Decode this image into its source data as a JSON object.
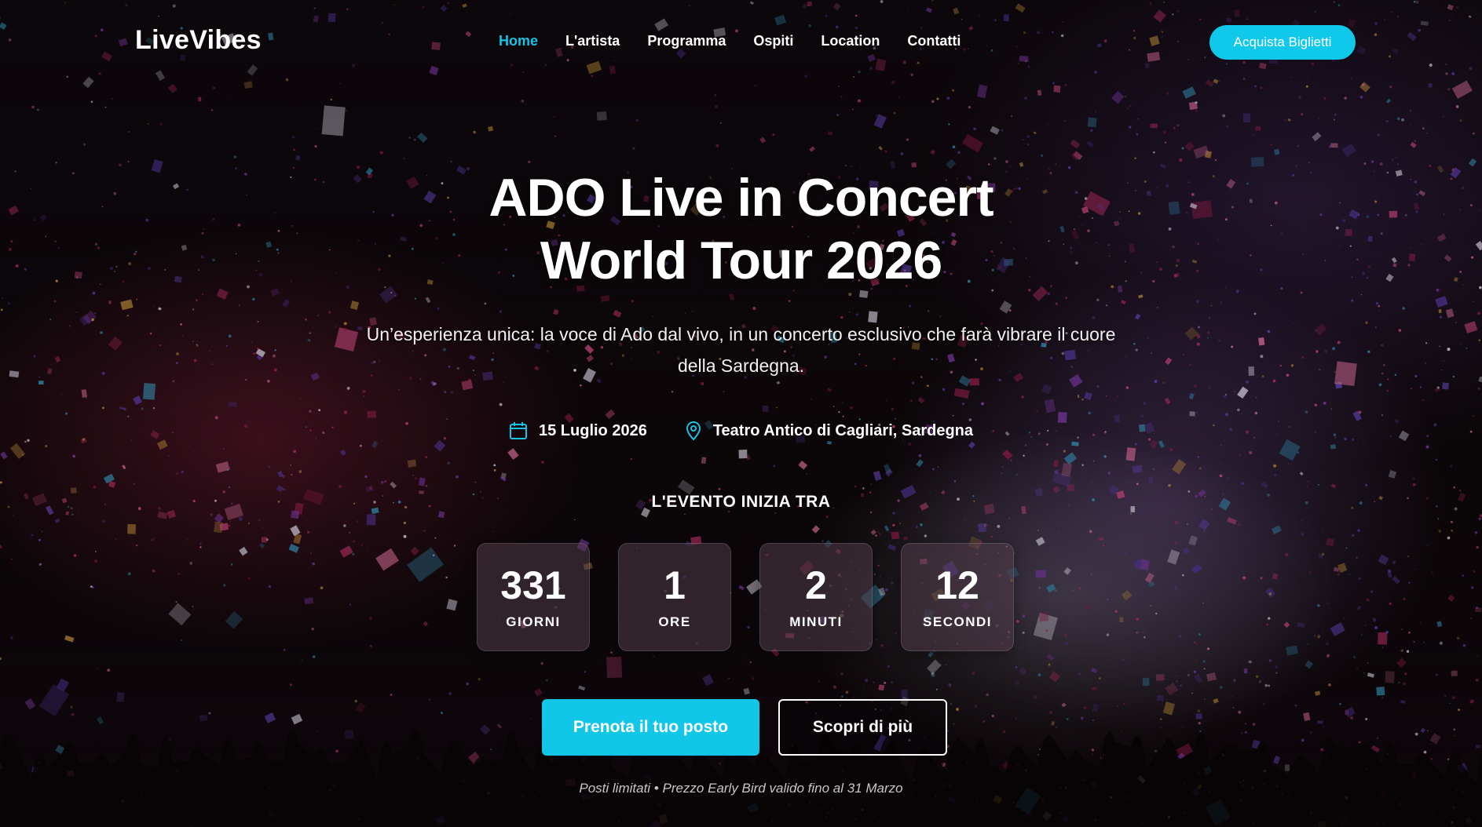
{
  "brand": {
    "logo": "LiveVibes",
    "accent": "#12c6e8"
  },
  "nav": {
    "items": [
      {
        "label": "Home",
        "active": true
      },
      {
        "label": "L'artista",
        "active": false
      },
      {
        "label": "Programma",
        "active": false
      },
      {
        "label": "Ospiti",
        "active": false
      },
      {
        "label": "Location",
        "active": false
      },
      {
        "label": "Contatti",
        "active": false
      }
    ],
    "cta": "Acquista Biglietti"
  },
  "hero": {
    "title_line1": "ADO Live in Concert",
    "title_line2": "World Tour 2026",
    "subtitle": "Un’esperienza unica: la voce di Ado dal vivo, in un concerto esclusivo che farà vibrare il cuore della Sardegna.",
    "date": {
      "icon": "calendar-icon",
      "text": "15 Luglio 2026"
    },
    "location": {
      "icon": "map-pin-icon",
      "text": "Teatro Antico di Cagliari, Sardegna"
    }
  },
  "countdown": {
    "label": "L'EVENTO INIZIA TRA",
    "units": [
      {
        "value": "331",
        "label": "GIORNI"
      },
      {
        "value": "1",
        "label": "ORE"
      },
      {
        "value": "2",
        "label": "MINUTI"
      },
      {
        "value": "12",
        "label": "SECONDI"
      }
    ]
  },
  "actions": {
    "primary": "Prenota il tuo posto",
    "secondary": "Scopri di più"
  },
  "note": "Posti limitati • Prezzo Early Bird valido fino al 31 Marzo"
}
